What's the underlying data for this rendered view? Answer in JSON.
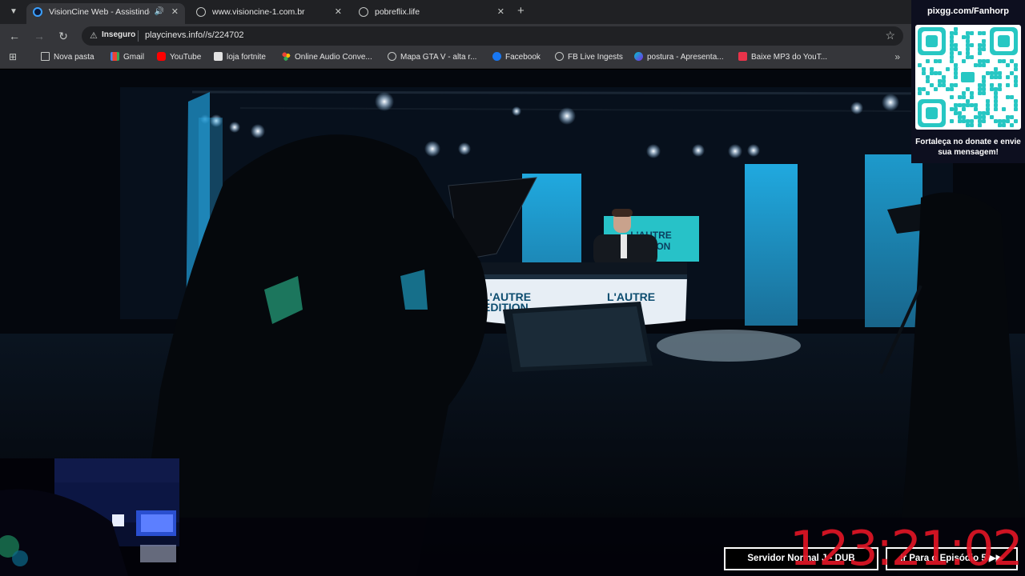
{
  "browser": {
    "tabs": [
      {
        "title": "VisionCine Web - Assistindo",
        "active": true,
        "favicon_color": "#3aa0ff",
        "audio": true
      },
      {
        "title": "www.visioncine-1.com.br",
        "active": false,
        "favicon_color": "#9aa0a6",
        "audio": false
      },
      {
        "title": "pobreflix.life",
        "active": false,
        "favicon_color": "#9aa0a6",
        "audio": false
      }
    ],
    "new_tab_icon": "+",
    "security_label": "Inseguro",
    "url": "playcinevs.info//s/224702",
    "bookmarks": [
      {
        "label": "Nova pasta",
        "icon": "folder-icon",
        "color": "#c4c7c5"
      },
      {
        "label": "Gmail",
        "icon": "gmail-icon",
        "color": "#ea4335"
      },
      {
        "label": "YouTube",
        "icon": "youtube-icon",
        "color": "#ff0000"
      },
      {
        "label": "loja fortnite",
        "icon": "fortnite-icon",
        "color": "#e3e3e3"
      },
      {
        "label": "Online Audio Conve...",
        "icon": "audio-converter-icon",
        "color": "#34a853"
      },
      {
        "label": "Mapa GTA V - alta r...",
        "icon": "globe-icon",
        "color": "#c4c7c5"
      },
      {
        "label": "Facebook",
        "icon": "facebook-icon",
        "color": "#1877f2"
      },
      {
        "label": "FB Live Ingests",
        "icon": "globe-icon",
        "color": "#c4c7c5"
      },
      {
        "label": "postura - Apresenta...",
        "icon": "canva-icon",
        "color": "#7d2ae8"
      },
      {
        "label": "Baixe MP3 do YouT...",
        "icon": "download-icon",
        "color": "#e8334a"
      }
    ]
  },
  "qr_overlay": {
    "title": "pixgg.com/Fanhorp",
    "caption": "Fortaleça no donate e envie sua mensagem!",
    "accent": "#27c7c3"
  },
  "scene": {
    "set_sign_text_1": "L'AUTRE",
    "set_sign_text_2": "EDITION"
  },
  "player": {
    "server_button": "Servidor Normal J - DUB",
    "next_episode_button": "Ir Para o Episódio 5 ▶▶",
    "timer": "123:21:02"
  }
}
